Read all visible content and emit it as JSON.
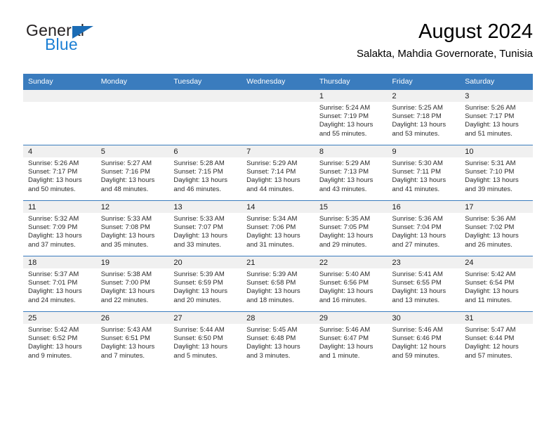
{
  "brand": {
    "name_part1": "General",
    "name_part2": "Blue",
    "triangle_color": "#1b6cb5",
    "blue_color": "#1b7fd4"
  },
  "header": {
    "title": "August 2024",
    "subtitle": "Salakta, Mahdia Governorate, Tunisia"
  },
  "theme": {
    "header_bg": "#3a7cbe",
    "daynum_bg": "#f0f0f0",
    "rule_color": "#3a7cbe"
  },
  "weekday_headers": [
    "Sunday",
    "Monday",
    "Tuesday",
    "Wednesday",
    "Thursday",
    "Friday",
    "Saturday"
  ],
  "weeks": [
    [
      {
        "day": "",
        "sunrise": "",
        "sunset": "",
        "daylight1": "",
        "daylight2": ""
      },
      {
        "day": "",
        "sunrise": "",
        "sunset": "",
        "daylight1": "",
        "daylight2": ""
      },
      {
        "day": "",
        "sunrise": "",
        "sunset": "",
        "daylight1": "",
        "daylight2": ""
      },
      {
        "day": "",
        "sunrise": "",
        "sunset": "",
        "daylight1": "",
        "daylight2": ""
      },
      {
        "day": "1",
        "sunrise": "Sunrise: 5:24 AM",
        "sunset": "Sunset: 7:19 PM",
        "daylight1": "Daylight: 13 hours",
        "daylight2": "and 55 minutes."
      },
      {
        "day": "2",
        "sunrise": "Sunrise: 5:25 AM",
        "sunset": "Sunset: 7:18 PM",
        "daylight1": "Daylight: 13 hours",
        "daylight2": "and 53 minutes."
      },
      {
        "day": "3",
        "sunrise": "Sunrise: 5:26 AM",
        "sunset": "Sunset: 7:17 PM",
        "daylight1": "Daylight: 13 hours",
        "daylight2": "and 51 minutes."
      }
    ],
    [
      {
        "day": "4",
        "sunrise": "Sunrise: 5:26 AM",
        "sunset": "Sunset: 7:17 PM",
        "daylight1": "Daylight: 13 hours",
        "daylight2": "and 50 minutes."
      },
      {
        "day": "5",
        "sunrise": "Sunrise: 5:27 AM",
        "sunset": "Sunset: 7:16 PM",
        "daylight1": "Daylight: 13 hours",
        "daylight2": "and 48 minutes."
      },
      {
        "day": "6",
        "sunrise": "Sunrise: 5:28 AM",
        "sunset": "Sunset: 7:15 PM",
        "daylight1": "Daylight: 13 hours",
        "daylight2": "and 46 minutes."
      },
      {
        "day": "7",
        "sunrise": "Sunrise: 5:29 AM",
        "sunset": "Sunset: 7:14 PM",
        "daylight1": "Daylight: 13 hours",
        "daylight2": "and 44 minutes."
      },
      {
        "day": "8",
        "sunrise": "Sunrise: 5:29 AM",
        "sunset": "Sunset: 7:13 PM",
        "daylight1": "Daylight: 13 hours",
        "daylight2": "and 43 minutes."
      },
      {
        "day": "9",
        "sunrise": "Sunrise: 5:30 AM",
        "sunset": "Sunset: 7:11 PM",
        "daylight1": "Daylight: 13 hours",
        "daylight2": "and 41 minutes."
      },
      {
        "day": "10",
        "sunrise": "Sunrise: 5:31 AM",
        "sunset": "Sunset: 7:10 PM",
        "daylight1": "Daylight: 13 hours",
        "daylight2": "and 39 minutes."
      }
    ],
    [
      {
        "day": "11",
        "sunrise": "Sunrise: 5:32 AM",
        "sunset": "Sunset: 7:09 PM",
        "daylight1": "Daylight: 13 hours",
        "daylight2": "and 37 minutes."
      },
      {
        "day": "12",
        "sunrise": "Sunrise: 5:33 AM",
        "sunset": "Sunset: 7:08 PM",
        "daylight1": "Daylight: 13 hours",
        "daylight2": "and 35 minutes."
      },
      {
        "day": "13",
        "sunrise": "Sunrise: 5:33 AM",
        "sunset": "Sunset: 7:07 PM",
        "daylight1": "Daylight: 13 hours",
        "daylight2": "and 33 minutes."
      },
      {
        "day": "14",
        "sunrise": "Sunrise: 5:34 AM",
        "sunset": "Sunset: 7:06 PM",
        "daylight1": "Daylight: 13 hours",
        "daylight2": "and 31 minutes."
      },
      {
        "day": "15",
        "sunrise": "Sunrise: 5:35 AM",
        "sunset": "Sunset: 7:05 PM",
        "daylight1": "Daylight: 13 hours",
        "daylight2": "and 29 minutes."
      },
      {
        "day": "16",
        "sunrise": "Sunrise: 5:36 AM",
        "sunset": "Sunset: 7:04 PM",
        "daylight1": "Daylight: 13 hours",
        "daylight2": "and 27 minutes."
      },
      {
        "day": "17",
        "sunrise": "Sunrise: 5:36 AM",
        "sunset": "Sunset: 7:02 PM",
        "daylight1": "Daylight: 13 hours",
        "daylight2": "and 26 minutes."
      }
    ],
    [
      {
        "day": "18",
        "sunrise": "Sunrise: 5:37 AM",
        "sunset": "Sunset: 7:01 PM",
        "daylight1": "Daylight: 13 hours",
        "daylight2": "and 24 minutes."
      },
      {
        "day": "19",
        "sunrise": "Sunrise: 5:38 AM",
        "sunset": "Sunset: 7:00 PM",
        "daylight1": "Daylight: 13 hours",
        "daylight2": "and 22 minutes."
      },
      {
        "day": "20",
        "sunrise": "Sunrise: 5:39 AM",
        "sunset": "Sunset: 6:59 PM",
        "daylight1": "Daylight: 13 hours",
        "daylight2": "and 20 minutes."
      },
      {
        "day": "21",
        "sunrise": "Sunrise: 5:39 AM",
        "sunset": "Sunset: 6:58 PM",
        "daylight1": "Daylight: 13 hours",
        "daylight2": "and 18 minutes."
      },
      {
        "day": "22",
        "sunrise": "Sunrise: 5:40 AM",
        "sunset": "Sunset: 6:56 PM",
        "daylight1": "Daylight: 13 hours",
        "daylight2": "and 16 minutes."
      },
      {
        "day": "23",
        "sunrise": "Sunrise: 5:41 AM",
        "sunset": "Sunset: 6:55 PM",
        "daylight1": "Daylight: 13 hours",
        "daylight2": "and 13 minutes."
      },
      {
        "day": "24",
        "sunrise": "Sunrise: 5:42 AM",
        "sunset": "Sunset: 6:54 PM",
        "daylight1": "Daylight: 13 hours",
        "daylight2": "and 11 minutes."
      }
    ],
    [
      {
        "day": "25",
        "sunrise": "Sunrise: 5:42 AM",
        "sunset": "Sunset: 6:52 PM",
        "daylight1": "Daylight: 13 hours",
        "daylight2": "and 9 minutes."
      },
      {
        "day": "26",
        "sunrise": "Sunrise: 5:43 AM",
        "sunset": "Sunset: 6:51 PM",
        "daylight1": "Daylight: 13 hours",
        "daylight2": "and 7 minutes."
      },
      {
        "day": "27",
        "sunrise": "Sunrise: 5:44 AM",
        "sunset": "Sunset: 6:50 PM",
        "daylight1": "Daylight: 13 hours",
        "daylight2": "and 5 minutes."
      },
      {
        "day": "28",
        "sunrise": "Sunrise: 5:45 AM",
        "sunset": "Sunset: 6:48 PM",
        "daylight1": "Daylight: 13 hours",
        "daylight2": "and 3 minutes."
      },
      {
        "day": "29",
        "sunrise": "Sunrise: 5:46 AM",
        "sunset": "Sunset: 6:47 PM",
        "daylight1": "Daylight: 13 hours",
        "daylight2": "and 1 minute."
      },
      {
        "day": "30",
        "sunrise": "Sunrise: 5:46 AM",
        "sunset": "Sunset: 6:46 PM",
        "daylight1": "Daylight: 12 hours",
        "daylight2": "and 59 minutes."
      },
      {
        "day": "31",
        "sunrise": "Sunrise: 5:47 AM",
        "sunset": "Sunset: 6:44 PM",
        "daylight1": "Daylight: 12 hours",
        "daylight2": "and 57 minutes."
      }
    ]
  ]
}
